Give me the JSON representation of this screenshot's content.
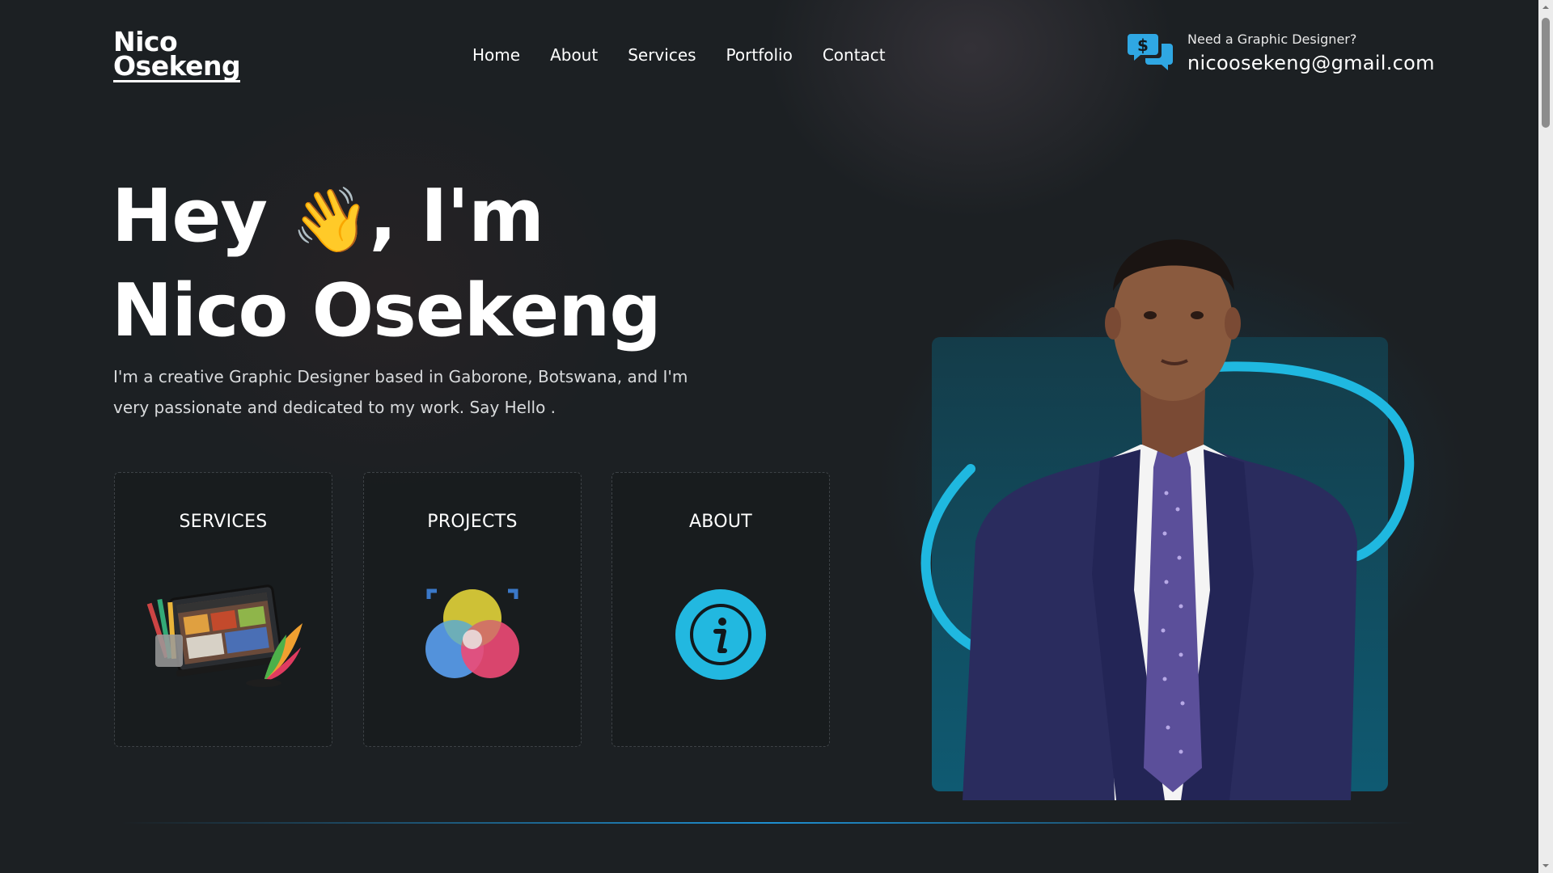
{
  "header": {
    "logo_line1": "Nico",
    "logo_line2": "Osekeng",
    "nav": [
      "Home",
      "About",
      "Services",
      "Portfolio",
      "Contact"
    ],
    "contact_question": "Need a Graphic Designer?",
    "contact_email": "nicoosekeng@gmail.com"
  },
  "hero": {
    "title_hey": "Hey",
    "wave_emoji": "👋",
    "title_im": ", I'm",
    "title_name": "Nico Osekeng",
    "description": "I'm a creative Graphic Designer based in Gaborone, Botswana, and I'm very passionate and dedicated to my work. Say Hello ."
  },
  "cards": [
    {
      "label": "SERVICES",
      "icon": "design-tablet-icon"
    },
    {
      "label": "PROJECTS",
      "icon": "color-circles-icon"
    },
    {
      "label": "ABOUT",
      "icon": "info-icon"
    }
  ],
  "colors": {
    "background": "#1c2023",
    "accent": "#1fb8e0",
    "chat_icon": "#2fa7e3"
  }
}
